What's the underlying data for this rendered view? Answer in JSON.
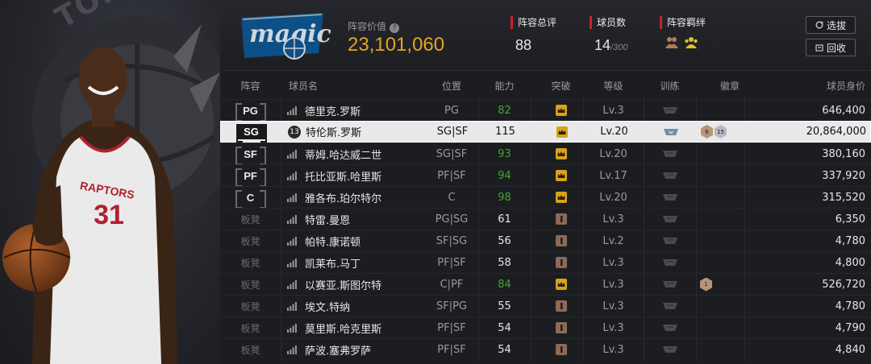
{
  "header": {
    "team_value_label": "阵容价值",
    "team_value": "23,101,060",
    "rating_label": "阵容总评",
    "rating_value": "88",
    "count_label": "球员数",
    "count_value": "14",
    "count_max": "/300",
    "bond_label": "阵容羁绊",
    "filter_button": "选拔",
    "back_button": "回收"
  },
  "left_panel": {
    "wordmark_top": "TORONTO",
    "jersey_name": "RAPTORS",
    "jersey_number": "31"
  },
  "table": {
    "columns": {
      "lineup": "阵容",
      "name": "球员名",
      "position": "位置",
      "rating": "能力",
      "breakthrough": "突破",
      "level": "等级",
      "training": "训练",
      "badges": "徽章",
      "value": "球员身价"
    },
    "rows": [
      {
        "slot": "PG",
        "name": "德里克.罗斯",
        "pos": "PG",
        "ovr": "82",
        "level": "Lv.3",
        "value": "646,400"
      },
      {
        "slot": "SG",
        "jersey": "13",
        "name": "特伦斯.罗斯",
        "pos": "SG|SF",
        "ovr": "115",
        "level": "Lv.20",
        "value": "20,864,000",
        "badge1": "6",
        "badge2": "15"
      },
      {
        "slot": "SF",
        "name": "蒂姆.哈达威二世",
        "pos": "SG|SF",
        "ovr": "93",
        "level": "Lv.20",
        "value": "380,160"
      },
      {
        "slot": "PF",
        "name": "托比亚斯.哈里斯",
        "pos": "PF|SF",
        "ovr": "94",
        "level": "Lv.17",
        "value": "337,920"
      },
      {
        "slot": "C",
        "name": "雅各布.珀尔特尔",
        "pos": "C",
        "ovr": "98",
        "level": "Lv.20",
        "value": "315,520"
      },
      {
        "slot": "板凳",
        "name": "特雷.曼恩",
        "pos": "PG|SG",
        "ovr": "61",
        "level": "Lv.3",
        "value": "6,350"
      },
      {
        "slot": "板凳",
        "name": "帕特.康诺顿",
        "pos": "SF|SG",
        "ovr": "56",
        "level": "Lv.2",
        "value": "4,780"
      },
      {
        "slot": "板凳",
        "name": "凯莱布.马丁",
        "pos": "PF|SF",
        "ovr": "58",
        "level": "Lv.3",
        "value": "4,800"
      },
      {
        "slot": "板凳",
        "name": "以赛亚.斯图尔特",
        "pos": "C|PF",
        "ovr": "84",
        "level": "Lv.3",
        "value": "526,720",
        "badge1": "1"
      },
      {
        "slot": "板凳",
        "name": "埃文.特纳",
        "pos": "SF|PG",
        "ovr": "55",
        "level": "Lv.3",
        "value": "4,780"
      },
      {
        "slot": "板凳",
        "name": "莫里斯.哈克里斯",
        "pos": "PF|SF",
        "ovr": "54",
        "level": "Lv.3",
        "value": "4,790"
      },
      {
        "slot": "板凳",
        "name": "萨波.塞弗罗萨",
        "pos": "PF|SF",
        "ovr": "54",
        "level": "Lv.3",
        "value": "4,840"
      }
    ]
  },
  "colors": {
    "accent_gold": "#e0a626",
    "accent_red": "#c8222a",
    "rating_green": "#43a531",
    "brk_gold": "#d9a21b",
    "brk_brown": "#8a6a58"
  }
}
